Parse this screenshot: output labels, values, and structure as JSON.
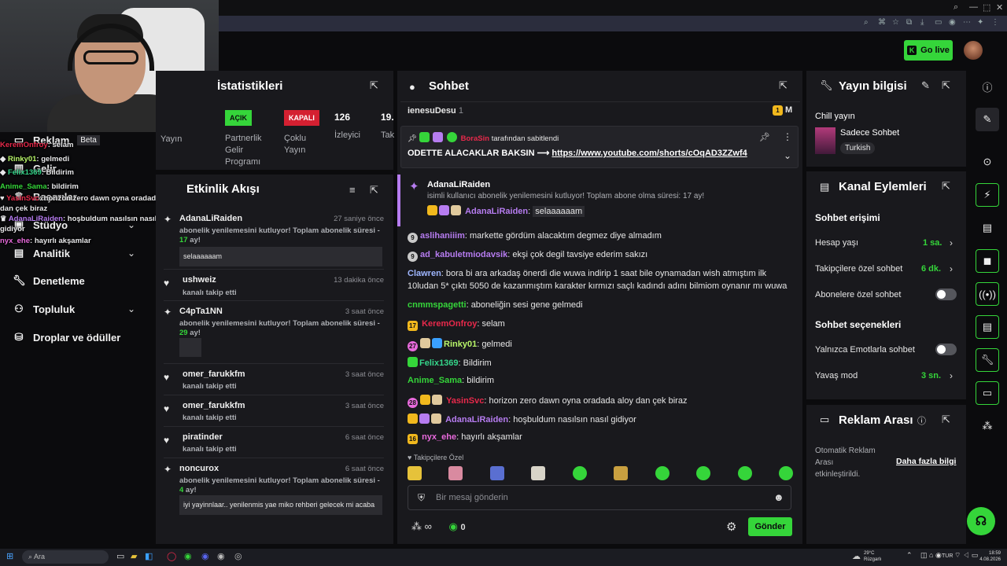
{
  "browser": {
    "controls": [
      "🔍",
      "—",
      "⬚",
      "✕"
    ]
  },
  "header": {
    "go_live_label": "Go live",
    "go_live_icon": "K"
  },
  "sidebar": {
    "items": [
      {
        "label": "Reklam",
        "extra": "Beta",
        "icon": "ad-icon"
      },
      {
        "label": "Gelir",
        "icon": "revenue-icon"
      },
      {
        "label": "Başarılar",
        "icon": "trophy-icon"
      },
      {
        "label": "Stüdyo",
        "icon": "studio-icon"
      },
      {
        "label": "Analitik",
        "icon": "analytics-icon"
      },
      {
        "label": "Denetleme",
        "icon": "wrench-icon"
      },
      {
        "label": "Topluluk",
        "icon": "community-icon"
      },
      {
        "label": "Droplar ve ödüller",
        "icon": "drops-icon"
      }
    ]
  },
  "overlay_chat": [
    {
      "user": "KeremOnfroy",
      "color": "#e8294b",
      "text": ": selam"
    },
    {
      "user": "Rinky01",
      "color": "#b8f56a",
      "text": ": gelmedi"
    },
    {
      "user": "Felix1369",
      "color": "#35d58a",
      "text": ": Bildirim"
    },
    {
      "user": "Anime_Sama",
      "color": "#35d53a",
      "text": ": bildirim"
    },
    {
      "user": "YasinSvc",
      "color": "#e8294b",
      "text": ": horizon zero dawn oyna oradada aloy dan çek biraz"
    },
    {
      "user": "AdanaLiRaiden",
      "color": "#b67cf0",
      "text": ": hoşbuldum nasılsın nasıl gidiyor"
    },
    {
      "user": "nyx_ehe",
      "color": "#e86adc",
      "text": ": hayırlı akşamlar"
    }
  ],
  "stats": {
    "title": "İstatistikleri",
    "cols": [
      {
        "label": "Yayın",
        "value": ""
      },
      {
        "badge": "AÇIK",
        "label": "Partnerlik Gelir Programı"
      },
      {
        "badge": "KAPALI",
        "label": "Çoklu Yayın"
      },
      {
        "value": "126",
        "label": "İzleyici"
      },
      {
        "value": "19.",
        "label": "Tak"
      }
    ]
  },
  "feed": {
    "title": "Etkinlik Akışı",
    "items": [
      {
        "name": "AdanaLiRaiden",
        "time": "27 saniye önce",
        "desc": "abonelik yenilemesini kutluyor! Toplam abonelik süresi - ",
        "months": "17",
        "desc_end": " ay!",
        "msg": "selaaaaaam",
        "icon": "star-icon"
      },
      {
        "name": "ushweiz",
        "time": "13 dakika önce",
        "desc": "kanalı takip etti",
        "icon": "heart-icon"
      },
      {
        "name": "C4pTa1NN",
        "time": "3 saat önce",
        "desc": "abonelik yenilemesini kutluyor! Toplam abonelik süresi - ",
        "months": "29",
        "desc_end": " ay!",
        "icon": "star-icon"
      },
      {
        "name": "omer_farukkfm",
        "time": "3 saat önce",
        "desc": "kanalı takip etti",
        "icon": "heart-icon"
      },
      {
        "name": "omer_farukkfm",
        "time": "3 saat önce",
        "desc": "kanalı takip etti",
        "icon": "heart-icon"
      },
      {
        "name": "piratinder",
        "time": "6 saat önce",
        "desc": "kanalı takip etti",
        "icon": "heart-icon"
      },
      {
        "name": "noncurox",
        "time": "6 saat önce",
        "desc": "abonelik yenilemesini kutluyor! Toplam abonelik süresi - ",
        "months": "4",
        "desc_end": " ay!",
        "msg": "iyi yayinnlaar.. yenilenmis yae miko rehberi gelecek mi acaba",
        "icon": "star-icon"
      }
    ]
  },
  "chat": {
    "title": "Sohbet",
    "top_user": "ienesuDesu",
    "top_count": "1",
    "pinned_by": "BoraSin",
    "pinned_suffix": "tarafından sabitlendi",
    "pinned_text": "ODETTE ALACAKLAR BAKSIN ⟶ ",
    "pinned_link": "https://www.youtube.com/shorts/cOqAD3ZZwf4",
    "sub_user": "AdanaLiRaiden",
    "sub_desc": "isimli kullanıcı abonelik yenilemesini kutluyor! Toplam abone olma süresi: 17 ay!",
    "sub_msg_user": "AdanaLiRaiden",
    "sub_msg": "selaaaaaam",
    "messages": [
      {
        "badge": "9",
        "user": "aslihaniiim",
        "color": "#b67cf0",
        "text": ": markette gördüm alacaktım degmez diye almadım"
      },
      {
        "badge": "9",
        "user": "ad_kabuletmiodavsik",
        "color": "#b67cf0",
        "text": ": ekşi çok degil tavsiye ederim sakızı"
      },
      {
        "badge": "",
        "user": "Clawren",
        "color": "#9fb6ff",
        "text": ": bora bi ara arkadaş önerdi die wuwa indirip 1 saat bile oynamadan wish atmıştım ilk"
      },
      {
        "badge": "",
        "user": "",
        "color": "#e6e6e6",
        "text": "10ludan 5* çıktı 5050 de kazanmıştım karakter kırmızı saçlı kadındı adını bilmiom oynanır mı wuwa"
      },
      {
        "badge": "",
        "user": "cnmmspagetti",
        "color": "#35d53a",
        "text": ": aboneliğin sesi gene gelmedi"
      },
      {
        "badge": "17",
        "user": "KeremOnfroy",
        "color": "#e8294b",
        "text": ": selam"
      },
      {
        "badge": "27",
        "user": "Rinky01",
        "color": "#b8f56a",
        "text": ": gelmedi"
      },
      {
        "badge": "",
        "user": "Felix1369",
        "color": "#35d58a",
        "text": ": Bildirim"
      },
      {
        "badge": "",
        "user": "Anime_Sama",
        "color": "#35d53a",
        "text": ": bildirim"
      },
      {
        "badge": "28",
        "user": "YasinSvc",
        "color": "#e8294b",
        "text": ": horizon zero dawn oyna oradada aloy dan çek biraz"
      },
      {
        "badge": "",
        "user": "AdanaLiRaiden",
        "color": "#b67cf0",
        "text": ": hoşbuldum nasılsın nasıl gidiyor"
      },
      {
        "badge": "16",
        "user": "nyx_ehe",
        "color": "#e86adc",
        "text": ": hayırlı akşamlar"
      }
    ],
    "emote_label": "Takipçilere Özel",
    "input_placeholder": "Bir mesaj gönderin",
    "infinity": "∞",
    "count": "0",
    "send_label": "Gönder"
  },
  "info": {
    "title": "Yayın bilgisi",
    "stream_title": "Chill yayın",
    "category": "Sadece Sohbet",
    "language": "Turkish"
  },
  "actions": {
    "title": "Kanal Eylemleri",
    "access_title": "Sohbet erişimi",
    "account_age_label": "Hesap yaşı",
    "account_age_value": "1 sa.",
    "followers_label": "Takipçilere özel sohbet",
    "followers_value": "6 dk.",
    "subs_label": "Abonelere özel sohbet",
    "options_title": "Sohbet seçenekleri",
    "emote_label": "Yalnızca Emotlarla sohbet",
    "slow_label": "Yavaş mod",
    "slow_value": "3 sn."
  },
  "adbreak": {
    "title": "Reklam Arası",
    "desc": "Otomatik Reklam Arası etkinleştirildi.",
    "more_label": "Daha fazla bilgi"
  },
  "taskbar": {
    "search_placeholder": "Ara",
    "weather_temp": "29°C",
    "weather_desc": "Rüzgarlı",
    "lang": "TUR",
    "time": "18:59",
    "date": "4.08.2026"
  },
  "colors": {
    "accent": "#35d53a",
    "panel": "#19191d",
    "background": "#0b0b0d"
  }
}
